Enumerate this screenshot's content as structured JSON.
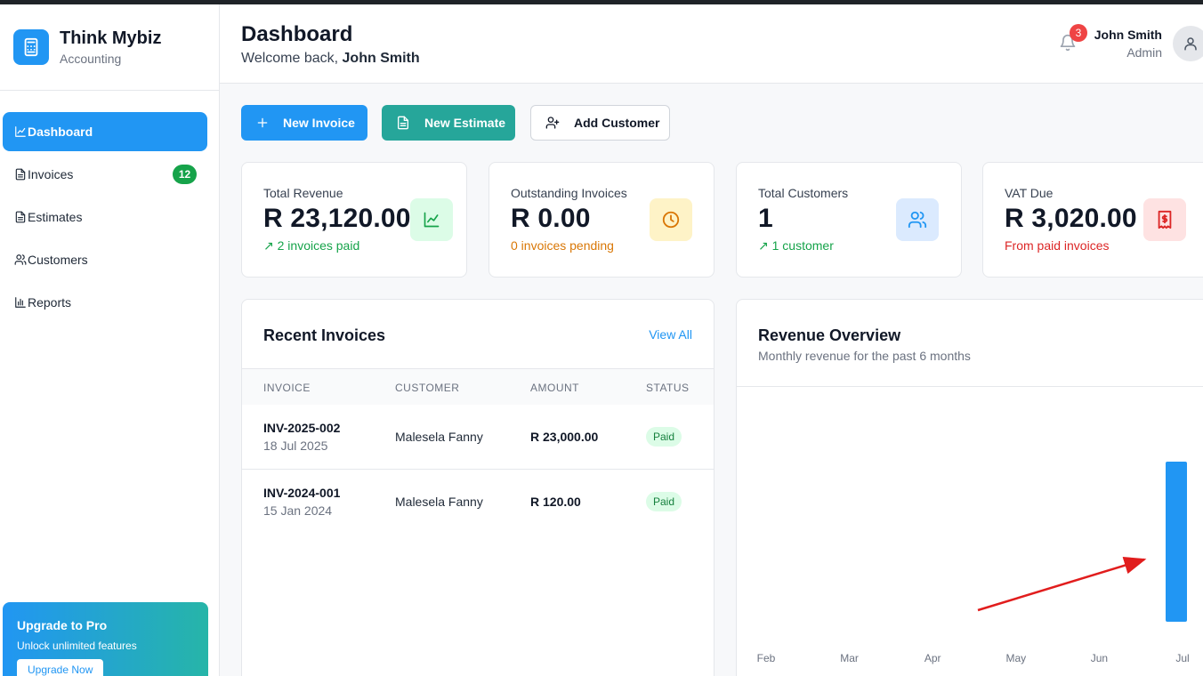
{
  "brand": {
    "name": "Think Mybiz",
    "subtitle": "Accounting"
  },
  "sidebar": {
    "items": [
      {
        "label": "Dashboard",
        "icon": "chart-line-icon",
        "active": true
      },
      {
        "label": "Invoices",
        "icon": "document-icon",
        "badge": "12"
      },
      {
        "label": "Estimates",
        "icon": "document-icon"
      },
      {
        "label": "Customers",
        "icon": "users-icon"
      },
      {
        "label": "Reports",
        "icon": "bar-chart-icon"
      }
    ],
    "upgrade": {
      "title": "Upgrade to Pro",
      "subtitle": "Unlock unlimited features",
      "button": "Upgrade Now"
    }
  },
  "header": {
    "title": "Dashboard",
    "welcome_prefix": "Welcome back,",
    "welcome_name": "John Smith",
    "notifications": "3",
    "user_name": "John Smith",
    "user_role": "Admin"
  },
  "actions": {
    "new_invoice": "New Invoice",
    "new_estimate": "New Estimate",
    "add_customer": "Add Customer"
  },
  "stats": [
    {
      "label": "Total Revenue",
      "value": "R 23,120.00",
      "sub": "↗ 2 invoices paid",
      "sub_color": "#16a34a",
      "icon": "trend-chart-icon",
      "icon_bg": "#dcfce7",
      "icon_color": "#16a34a"
    },
    {
      "label": "Outstanding Invoices",
      "value": "R 0.00",
      "sub": "0 invoices pending",
      "sub_color": "#d97706",
      "icon": "clock-icon",
      "icon_bg": "#fef3c7",
      "icon_color": "#d97706"
    },
    {
      "label": "Total Customers",
      "value": "1",
      "sub": "↗ 1 customer",
      "sub_color": "#16a34a",
      "icon": "users-icon",
      "icon_bg": "#dbeafe",
      "icon_color": "#2196f3"
    },
    {
      "label": "VAT Due",
      "value": "R 3,020.00",
      "sub": "From paid invoices",
      "sub_color": "#dc2626",
      "icon": "receipt-icon",
      "icon_bg": "#fee2e2",
      "icon_color": "#dc2626"
    }
  ],
  "recent": {
    "title": "Recent Invoices",
    "view_all": "View All",
    "columns": [
      "INVOICE",
      "CUSTOMER",
      "AMOUNT",
      "STATUS"
    ],
    "rows": [
      {
        "invoice": "INV-2025-002",
        "date": "18 Jul 2025",
        "customer": "Malesela Fanny",
        "amount": "R 23,000.00",
        "status": "Paid"
      },
      {
        "invoice": "INV-2024-001",
        "date": "15 Jan 2024",
        "customer": "Malesela Fanny",
        "amount": "R 120.00",
        "status": "Paid"
      }
    ]
  },
  "revenue": {
    "title": "Revenue Overview",
    "subtitle": "Monthly revenue for the past 6 months"
  },
  "chart_data": {
    "type": "bar",
    "categories": [
      "Feb",
      "Mar",
      "Apr",
      "May",
      "Jun",
      "Jul"
    ],
    "values": [
      0,
      0,
      0,
      0,
      0,
      23000
    ],
    "ylim": [
      0,
      23000
    ],
    "color": "#2196f3",
    "grid": false
  },
  "colors": {
    "primary": "#2196f3",
    "teal": "#26a69a",
    "success": "#16a34a",
    "danger": "#ef4444"
  }
}
